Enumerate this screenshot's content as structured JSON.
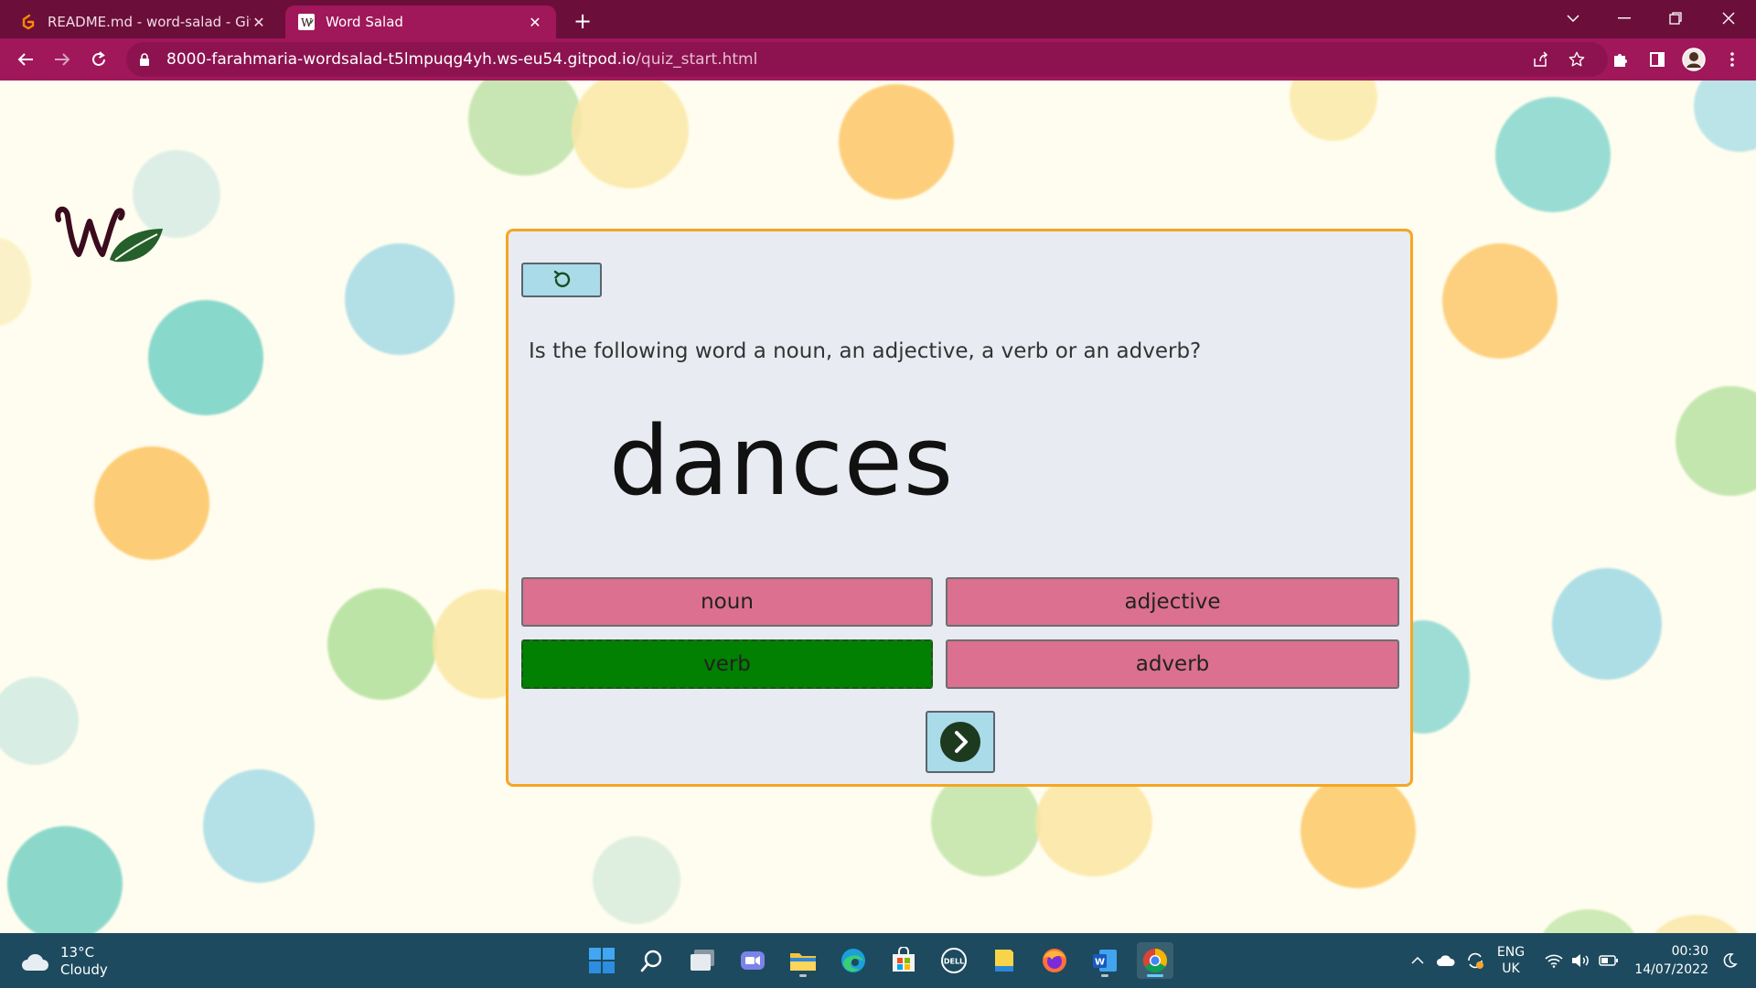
{
  "browser": {
    "tabs": [
      {
        "title": "README.md - word-salad - Gitpod",
        "active": false
      },
      {
        "title": "Word Salad",
        "active": true
      }
    ],
    "url_host": "8000-farahmaria-wordsalad-t5lmpuqg4yh.ws-eu54.gitpod.io",
    "url_path": "/quiz_start.html"
  },
  "quiz": {
    "question": "Is the following word a noun, an adjective, a verb or an adverb?",
    "word": "dances",
    "answers": [
      {
        "label": "noun",
        "state": "default"
      },
      {
        "label": "adjective",
        "state": "default"
      },
      {
        "label": "verb",
        "state": "correct"
      },
      {
        "label": "adverb",
        "state": "default"
      }
    ]
  },
  "taskbar": {
    "weather_temp": "13°C",
    "weather_desc": "Cloudy",
    "language": "ENG",
    "region": "UK",
    "time": "00:30",
    "date": "14/07/2022"
  },
  "colors": {
    "tab_bar": "#6b0f3a",
    "toolbar": "#a0175a",
    "page_bg": "#fffdef",
    "card_bg": "#e8ebf1",
    "card_border": "#f5a623",
    "answer_default": "#dc7090",
    "answer_correct": "#018001",
    "icon_button": "#a9dbe8",
    "taskbar": "#1d4a5e"
  }
}
